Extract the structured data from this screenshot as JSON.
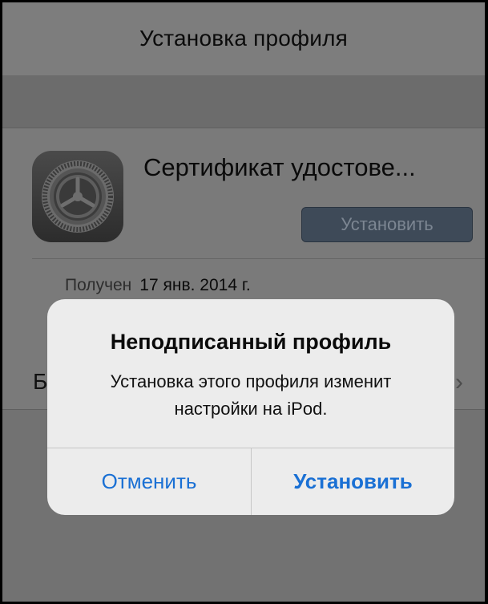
{
  "navbar": {
    "title": "Установка профиля"
  },
  "profile": {
    "icon": "settings-gear-icon",
    "title": "Сертификат удостове...",
    "install_label": "Установить",
    "received_label": "Получен",
    "received_value": "17 янв. 2014 г.",
    "more_row_partial": "Б",
    "more_chevron": "›"
  },
  "alert": {
    "title": "Неподписанный профиль",
    "message": "Установка этого профиля изменит настройки на iPod.",
    "cancel_label": "Отменить",
    "confirm_label": "Установить",
    "accent_color": "#1a70d4"
  }
}
